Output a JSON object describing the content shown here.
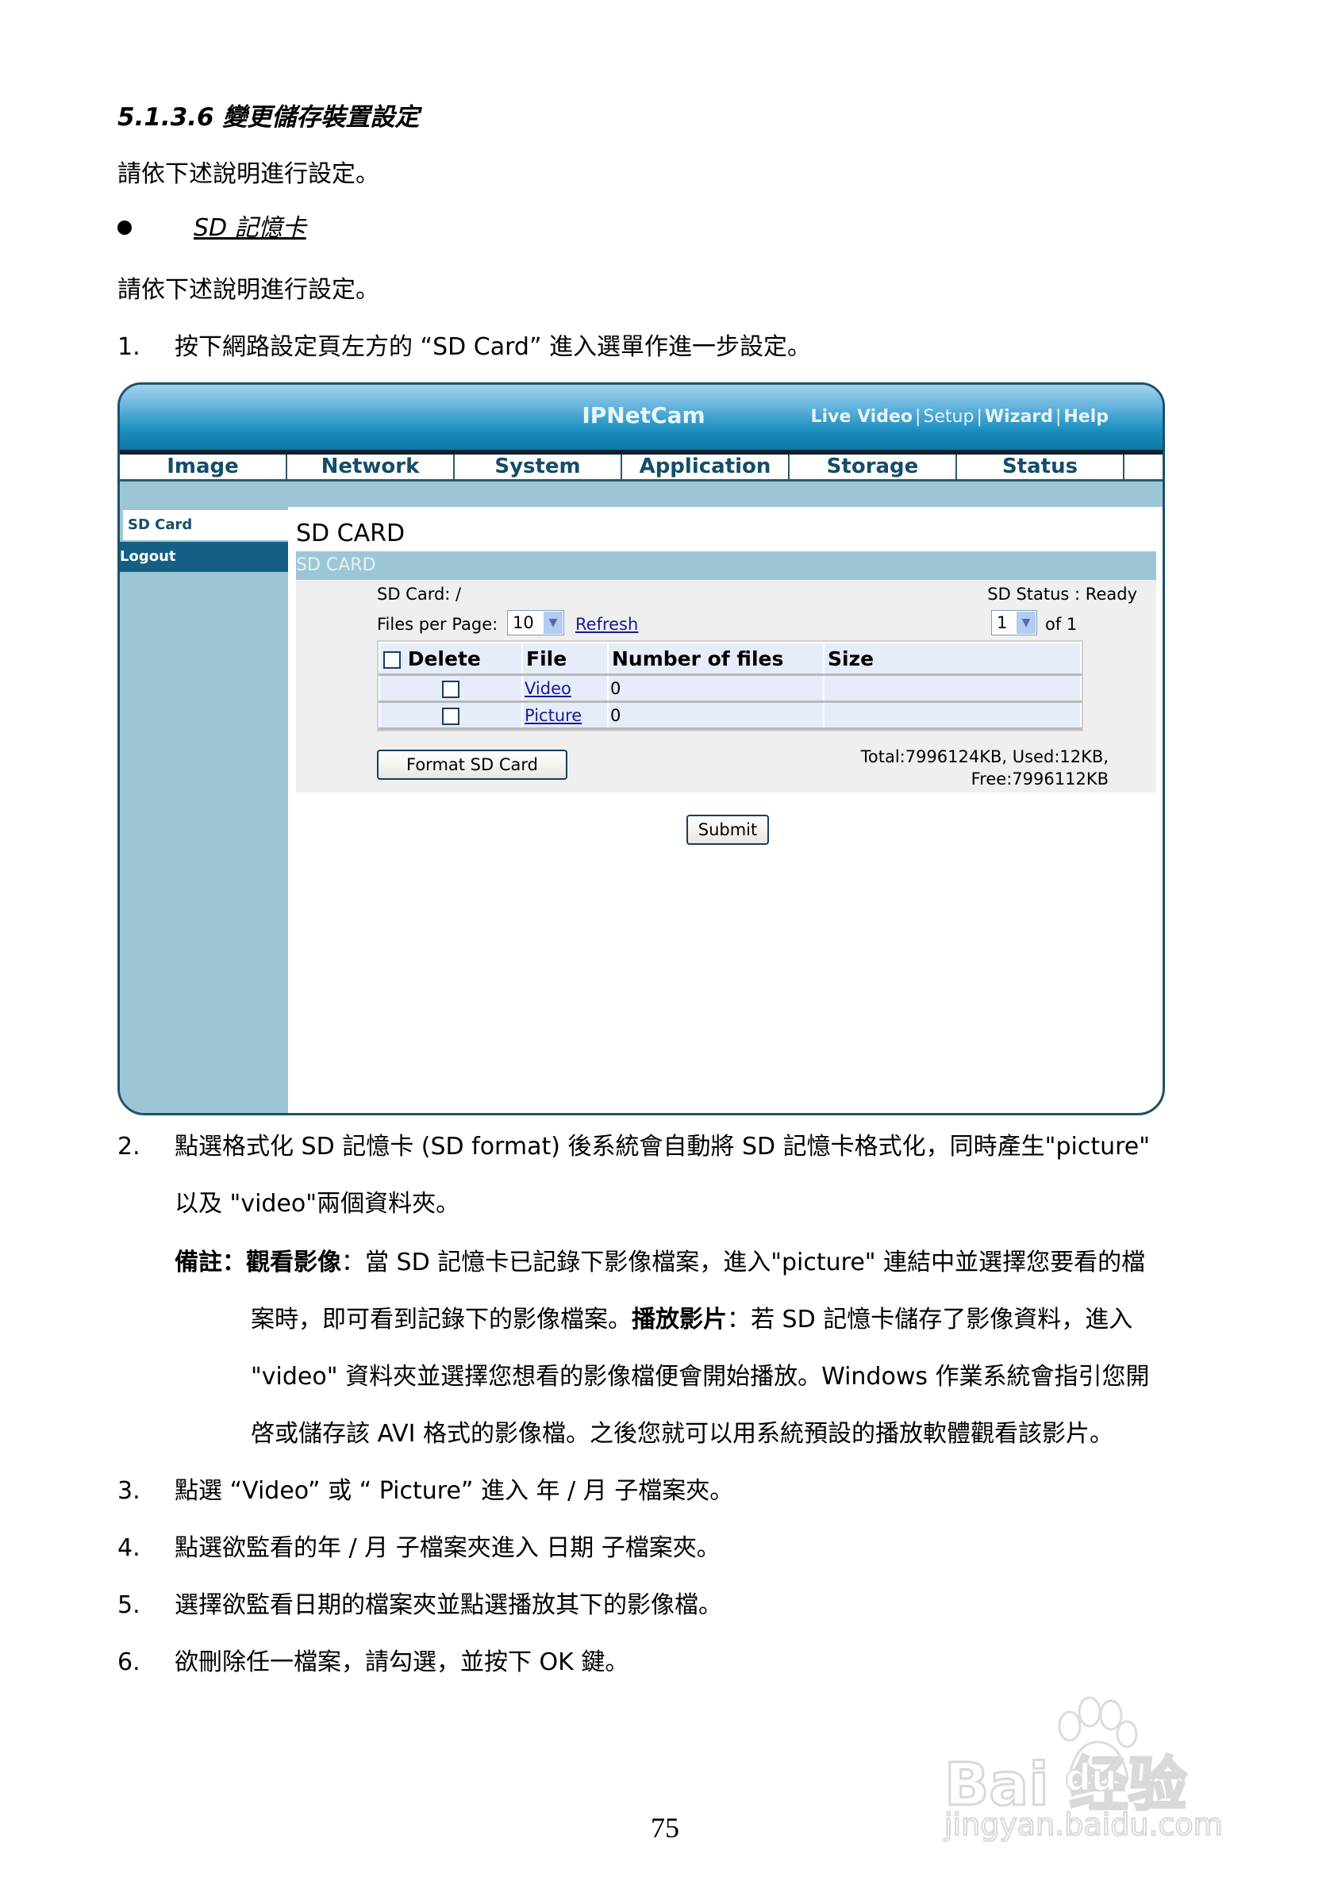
{
  "doc": {
    "heading": "5.1.3.6 變更儲存裝置設定",
    "intro": "請依下述說明進行設定。",
    "bullet": "SD 記憶卡",
    "intro2": "請依下述說明進行設定。",
    "steps": [
      {
        "num": "1.",
        "text": "按下網路設定頁左方的 “SD Card” 進入選單作進一步設定。"
      },
      {
        "num": "2.",
        "text": "點選格式化 SD 記憶卡 (SD format) 後系統會自動將 SD 記憶卡格式化，同時產生\"picture\"",
        "text2": "以及 \"video\"兩個資料夾。"
      },
      {
        "num": "3.",
        "text": "點選 “Video” 或 “ Picture” 進入 年 / 月 子檔案夾。"
      },
      {
        "num": "4.",
        "text": "點選欲監看的年 / 月 子檔案夾進入 日期 子檔案夾。"
      },
      {
        "num": "5.",
        "text": "選擇欲監看日期的檔案夾並點選播放其下的影像檔。"
      },
      {
        "num": "6.",
        "text": "欲刪除任一檔案，請勾選，並按下 OK 鍵。"
      }
    ],
    "note": {
      "label": "備註：",
      "view_label": "觀看影像",
      "line1_rest": "：當 SD 記憶卡已記錄下影像檔案，進入\"picture\" 連結中並選擇您要看的檔",
      "line2_a": "案時，即可看到記錄下的影像檔案。",
      "play_label": "播放影片",
      "line2_rest": "：若 SD 記憶卡儲存了影像資料，進入",
      "line3": "\"video\" 資料夾並選擇您想看的影像檔便會開始播放。Windows 作業系統會指引您開",
      "line4": "啓或儲存該 AVI 格式的影像檔。之後您就可以用系統預設的播放軟體觀看該影片。"
    },
    "page_number": "75"
  },
  "ui": {
    "brand": "IPNetCam",
    "top_links": [
      {
        "label": "Live Video"
      },
      {
        "label": "Setup"
      },
      {
        "label": "Wizard"
      },
      {
        "label": "Help"
      }
    ],
    "link_separator": "|",
    "nav_tabs": [
      "Image",
      "Network",
      "System",
      "Application",
      "Storage",
      "Status"
    ],
    "sidebar": [
      {
        "label": "SD Card",
        "active": true
      },
      {
        "label": "Logout"
      }
    ],
    "page_title": "SD CARD",
    "section_title": "SD CARD",
    "sd_card_path": "SD Card: /",
    "sd_status": "SD Status : Ready",
    "files_per_page_label": "Files per Page:",
    "files_per_page_value": "10",
    "refresh_label": "Refresh",
    "page_select_value": "1",
    "page_of_label": "of 1",
    "table": {
      "headers": [
        "Delete",
        "File",
        "Number of files",
        "Size"
      ],
      "rows": [
        {
          "file": "Video",
          "count": "0",
          "size": ""
        },
        {
          "file": "Picture",
          "count": "0",
          "size": ""
        }
      ]
    },
    "format_button": "Format SD Card",
    "totals_line1": "Total:7996124KB, Used:12KB,",
    "totals_line2": "Free:7996112KB",
    "submit_button": "Submit",
    "colors": {
      "header_dark": "#0d79a8",
      "header_light": "#a3d3ee",
      "nav_text": "#144d68",
      "sidebar_bg": "#9cc6d6",
      "logout_bg": "#155f85",
      "table_cell": "#e6ecfa",
      "link": "#1a1a8f"
    }
  },
  "watermark": {
    "brand": "Bai  经验",
    "brand_inner": "du",
    "url": "jingyan.baidu.com"
  }
}
